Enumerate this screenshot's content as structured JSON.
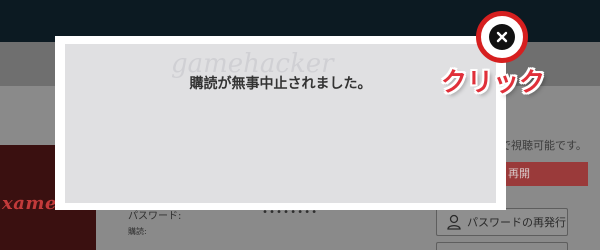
{
  "background": {
    "poster_text": "xame.",
    "status_text": "で視聴可能です。",
    "red_button_label": "再開",
    "password_label": "パスワード:",
    "password_value": "••••••••",
    "subscription_label": "購読:",
    "reissue_button_label": "パスワードの再発行"
  },
  "modal": {
    "watermark": "gamehacker",
    "message": "購読が無事中止されました。",
    "close_icon": "close-icon"
  },
  "annotation": {
    "label": "クリック",
    "color": "#e0303a"
  }
}
